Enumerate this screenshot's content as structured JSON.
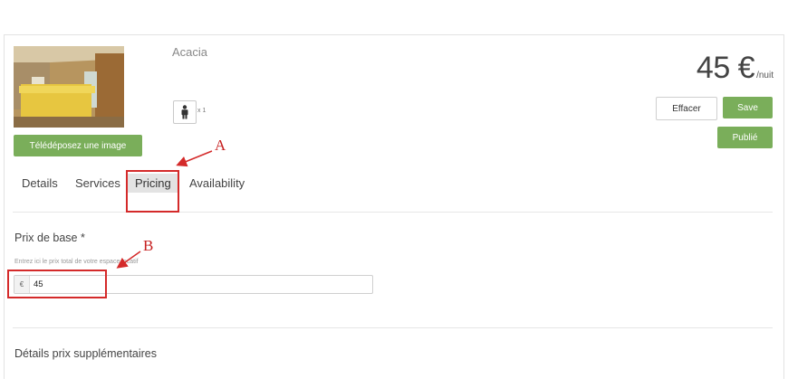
{
  "room": {
    "name": "Acacia",
    "capacity_count": "x 1"
  },
  "upload": {
    "label": "Télédéposez une image"
  },
  "price": {
    "value": "45 €",
    "unit": "/nuit"
  },
  "actions": {
    "clear": "Effacer",
    "save": "Save",
    "publish": "Publié"
  },
  "tabs": [
    {
      "label": "Details"
    },
    {
      "label": "Services"
    },
    {
      "label": "Pricing",
      "active": true
    },
    {
      "label": "Availability"
    }
  ],
  "base_price": {
    "label": "Prix de base *",
    "hint": "Entrez ici le prix total de votre espace locatif",
    "currency": "€",
    "value": "45"
  },
  "extra_section": {
    "title": "Détails prix supplémentaires"
  },
  "annotations": {
    "a": "A",
    "b": "B"
  },
  "colors": {
    "accent_green": "#7aae5a",
    "annotation_red": "#d42a2a"
  },
  "icons": {
    "capacity": "person-icon"
  }
}
